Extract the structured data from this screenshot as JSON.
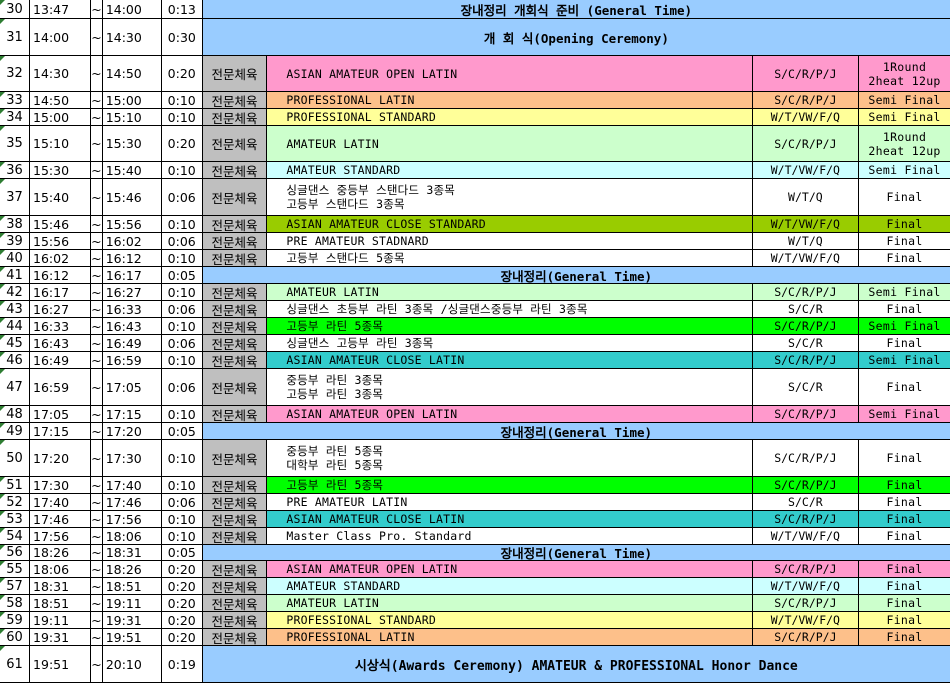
{
  "colors": {
    "header_blue": "#99ccff",
    "pink": "#ff99cc",
    "orange": "#fdc08a",
    "yellow": "#ffff99",
    "lightgreen": "#ccffcc",
    "cyan": "#ccffff",
    "olive": "#99cc00",
    "green": "#00ff00",
    "teal": "#33cccc",
    "gray": "#bfbfbf"
  },
  "rows": [
    {
      "num": "30",
      "start": "13:47",
      "tilde": "~",
      "end": "14:00",
      "dur": "0:13",
      "span": "장내정리 개회식 준비 (General Time)"
    },
    {
      "num": "31",
      "start": "14:00",
      "tilde": "~",
      "end": "14:30",
      "dur": "0:30",
      "span": "개 회 식(Opening Ceremony)"
    },
    {
      "num": "32",
      "start": "14:30",
      "tilde": "~",
      "end": "14:50",
      "dur": "0:20",
      "cat": "전문체육",
      "event": [
        "ASIAN AMATEUR OPEN LATIN"
      ],
      "dance": "S/C/R/P/J",
      "round": [
        "1Round",
        "2heat 12up"
      ],
      "bg": "pink"
    },
    {
      "num": "33",
      "start": "14:50",
      "tilde": "~",
      "end": "15:00",
      "dur": "0:10",
      "cat": "전문체육",
      "event": [
        "PROFESSIONAL LATIN"
      ],
      "dance": "S/C/R/P/J",
      "round": [
        "Semi Final"
      ],
      "bg": "orange"
    },
    {
      "num": "34",
      "start": "15:00",
      "tilde": "~",
      "end": "15:10",
      "dur": "0:10",
      "cat": "전문체육",
      "event": [
        "PROFESSIONAL STANDARD"
      ],
      "dance": "W/T/VW/F/Q",
      "round": [
        "Semi Final"
      ],
      "bg": "yellow"
    },
    {
      "num": "35",
      "start": "15:10",
      "tilde": "~",
      "end": "15:30",
      "dur": "0:20",
      "cat": "전문체육",
      "event": [
        "AMATEUR LATIN"
      ],
      "dance": "S/C/R/P/J",
      "round": [
        "1Round",
        "2heat 12up"
      ],
      "bg": "lightgreen"
    },
    {
      "num": "36",
      "start": "15:30",
      "tilde": "~",
      "end": "15:40",
      "dur": "0:10",
      "cat": "전문체육",
      "event": [
        "AMATEUR STANDARD"
      ],
      "dance": "W/T/VW/F/Q",
      "round": [
        "Semi Final"
      ],
      "bg": "cyan"
    },
    {
      "num": "37",
      "start": "15:40",
      "tilde": "~",
      "end": "15:46",
      "dur": "0:06",
      "cat": "전문체육",
      "event": [
        "싱글댄스 중등부 스탠다드 3종목",
        "고등부 스탠다드 3종목"
      ],
      "dance": "W/T/Q",
      "round": [
        "Final"
      ],
      "bg": "white"
    },
    {
      "num": "38",
      "start": "15:46",
      "tilde": "~",
      "end": "15:56",
      "dur": "0:10",
      "cat": "전문체육",
      "event": [
        "ASIAN AMATEUR CLOSE STANDARD"
      ],
      "dance": "W/T/VW/F/Q",
      "round": [
        "Final"
      ],
      "bg": "olive"
    },
    {
      "num": "39",
      "start": "15:56",
      "tilde": "~",
      "end": "16:02",
      "dur": "0:06",
      "cat": "전문체육",
      "event": [
        "PRE AMATEUR STADNARD"
      ],
      "dance": "W/T/Q",
      "round": [
        "Final"
      ],
      "bg": "white"
    },
    {
      "num": "40",
      "start": "16:02",
      "tilde": "~",
      "end": "16:12",
      "dur": "0:10",
      "cat": "전문체육",
      "event": [
        "고등부 스탠다드 5종목"
      ],
      "dance": "W/T/VW/F/Q",
      "round": [
        "Final"
      ],
      "bg": "white"
    },
    {
      "num": "41",
      "start": "16:12",
      "tilde": "~",
      "end": "16:17",
      "dur": "0:05",
      "span": "장내정리(General Time)"
    },
    {
      "num": "42",
      "start": "16:17",
      "tilde": "~",
      "end": "16:27",
      "dur": "0:10",
      "cat": "전문체육",
      "event": [
        "AMATEUR LATIN"
      ],
      "dance": "S/C/R/P/J",
      "round": [
        "Semi Final"
      ],
      "bg": "lightgreen"
    },
    {
      "num": "43",
      "start": "16:27",
      "tilde": "~",
      "end": "16:33",
      "dur": "0:06",
      "cat": "전문체육",
      "event": [
        "싱글댄스 초등부 라틴 3종목 /싱글댄스중등부 라틴 3종목"
      ],
      "dance": "S/C/R",
      "round": [
        "Final"
      ],
      "bg": "white"
    },
    {
      "num": "44",
      "start": "16:33",
      "tilde": "~",
      "end": "16:43",
      "dur": "0:10",
      "cat": "전문체육",
      "event": [
        "고등부 라틴 5종목"
      ],
      "dance": "S/C/R/P/J",
      "round": [
        "Semi Final"
      ],
      "bg": "green"
    },
    {
      "num": "45",
      "start": "16:43",
      "tilde": "~",
      "end": "16:49",
      "dur": "0:06",
      "cat": "전문체육",
      "event": [
        "싱글댄스 고등부 라틴 3종목"
      ],
      "dance": "S/C/R",
      "round": [
        "Final"
      ],
      "bg": "white"
    },
    {
      "num": "46",
      "start": "16:49",
      "tilde": "~",
      "end": "16:59",
      "dur": "0:10",
      "cat": "전문체육",
      "event": [
        "ASIAN AMATEUR CLOSE LATIN"
      ],
      "dance": "S/C/R/P/J",
      "round": [
        "Semi Final"
      ],
      "bg": "teal"
    },
    {
      "num": "47",
      "start": "16:59",
      "tilde": "~",
      "end": "17:05",
      "dur": "0:06",
      "cat": "전문체육",
      "event": [
        "중등부 라틴 3종목",
        "고등부 라틴 3종목"
      ],
      "dance": "S/C/R",
      "round": [
        "Final"
      ],
      "bg": "white"
    },
    {
      "num": "48",
      "start": "17:05",
      "tilde": "~",
      "end": "17:15",
      "dur": "0:10",
      "cat": "전문체육",
      "event": [
        "ASIAN AMATEUR OPEN LATIN"
      ],
      "dance": "S/C/R/P/J",
      "round": [
        "Semi Final"
      ],
      "bg": "pink"
    },
    {
      "num": "49",
      "start": "17:15",
      "tilde": "~",
      "end": "17:20",
      "dur": "0:05",
      "span": "장내정리(General Time)"
    },
    {
      "num": "50",
      "start": "17:20",
      "tilde": "~",
      "end": "17:30",
      "dur": "0:10",
      "cat": "전문체육",
      "event": [
        "중등부 라틴 5종목",
        "대학부 라틴 5종목"
      ],
      "dance": "S/C/R/P/J",
      "round": [
        "Final"
      ],
      "bg": "white"
    },
    {
      "num": "51",
      "start": "17:30",
      "tilde": "~",
      "end": "17:40",
      "dur": "0:10",
      "cat": "전문체육",
      "event": [
        "고등부 라틴 5종목"
      ],
      "dance": "S/C/R/P/J",
      "round": [
        "Final"
      ],
      "bg": "green"
    },
    {
      "num": "52",
      "start": "17:40",
      "tilde": "~",
      "end": "17:46",
      "dur": "0:06",
      "cat": "전문체육",
      "event": [
        "PRE AMATEUR LATIN"
      ],
      "dance": "S/C/R",
      "round": [
        "Final"
      ],
      "bg": "white"
    },
    {
      "num": "53",
      "start": "17:46",
      "tilde": "~",
      "end": "17:56",
      "dur": "0:10",
      "cat": "전문체육",
      "event": [
        "ASIAN AMATEUR CLOSE LATIN"
      ],
      "dance": "S/C/R/P/J",
      "round": [
        "Final"
      ],
      "bg": "teal"
    },
    {
      "num": "54",
      "start": "17:56",
      "tilde": "~",
      "end": "18:06",
      "dur": "0:10",
      "cat": "전문체육",
      "event": [
        "Master Class Pro. Standard"
      ],
      "dance": "W/T/VW/F/Q",
      "round": [
        "Final"
      ],
      "bg": "white"
    },
    {
      "num": "56",
      "start": "18:26",
      "tilde": "~",
      "end": "18:31",
      "dur": "0:05",
      "span": "장내정리(General Time)"
    },
    {
      "num": "55",
      "start": "18:06",
      "tilde": "~",
      "end": "18:26",
      "dur": "0:20",
      "cat": "전문체육",
      "event": [
        "ASIAN AMATEUR OPEN LATIN"
      ],
      "dance": "S/C/R/P/J",
      "round": [
        "Final"
      ],
      "bg": "pink"
    },
    {
      "num": "57",
      "start": "18:31",
      "tilde": "~",
      "end": "18:51",
      "dur": "0:20",
      "cat": "전문체육",
      "event": [
        "AMATEUR STANDARD"
      ],
      "dance": "W/T/VW/F/Q",
      "round": [
        "Final"
      ],
      "bg": "cyan"
    },
    {
      "num": "58",
      "start": "18:51",
      "tilde": "~",
      "end": "19:11",
      "dur": "0:20",
      "cat": "전문체육",
      "event": [
        "AMATEUR LATIN"
      ],
      "dance": "S/C/R/P/J",
      "round": [
        "Final"
      ],
      "bg": "lightgreen"
    },
    {
      "num": "59",
      "start": "19:11",
      "tilde": "~",
      "end": "19:31",
      "dur": "0:20",
      "cat": "전문체육",
      "event": [
        "PROFESSIONAL STANDARD"
      ],
      "dance": "W/T/VW/F/Q",
      "round": [
        "Final"
      ],
      "bg": "yellow"
    },
    {
      "num": "60",
      "start": "19:31",
      "tilde": "~",
      "end": "19:51",
      "dur": "0:20",
      "cat": "전문체육",
      "event": [
        "PROFESSIONAL LATIN"
      ],
      "dance": "S/C/R/P/J",
      "round": [
        "Final"
      ],
      "bg": "orange"
    },
    {
      "num": "61",
      "start": "19:51",
      "tilde": "~",
      "end": "20:10",
      "dur": "0:19",
      "span": "시상식(Awards Ceremony) AMATEUR & PROFESSIONAL Honor Dance"
    }
  ]
}
